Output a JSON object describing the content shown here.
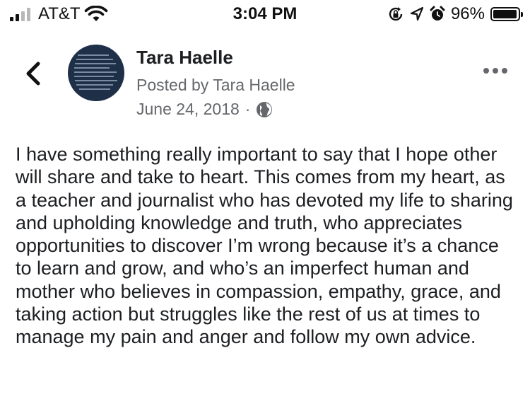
{
  "status_bar": {
    "carrier": "AT&T",
    "time": "3:04 PM",
    "battery_percent_label": "96%",
    "battery_level": 0.96,
    "icons": [
      "cellular-signal-icon",
      "wifi-icon",
      "orientation-lock-icon",
      "location-arrow-icon",
      "alarm-icon",
      "battery-icon"
    ]
  },
  "post": {
    "author": "Tara Haelle",
    "posted_by": "Posted by Tara Haelle",
    "date": "June 24, 2018",
    "separator": "·",
    "visibility_icon": "globe-icon",
    "text": "I have something really important to say that I hope other will share and take to heart. This comes from my heart, as a teacher and journalist who has devoted my life to sharing and upholding knowledge and truth, who appreciates opportunities to discover I’m wrong because it’s a chance to learn and grow, and who’s an imperfect human and mother who believes in compassion, empathy, grace, and taking action but struggles like the rest of us at times to manage my pain and anger and follow my own advice."
  },
  "colors": {
    "primary_text": "#1c1e21",
    "secondary_text": "#65676b",
    "avatar_background": "#1e2f48"
  }
}
